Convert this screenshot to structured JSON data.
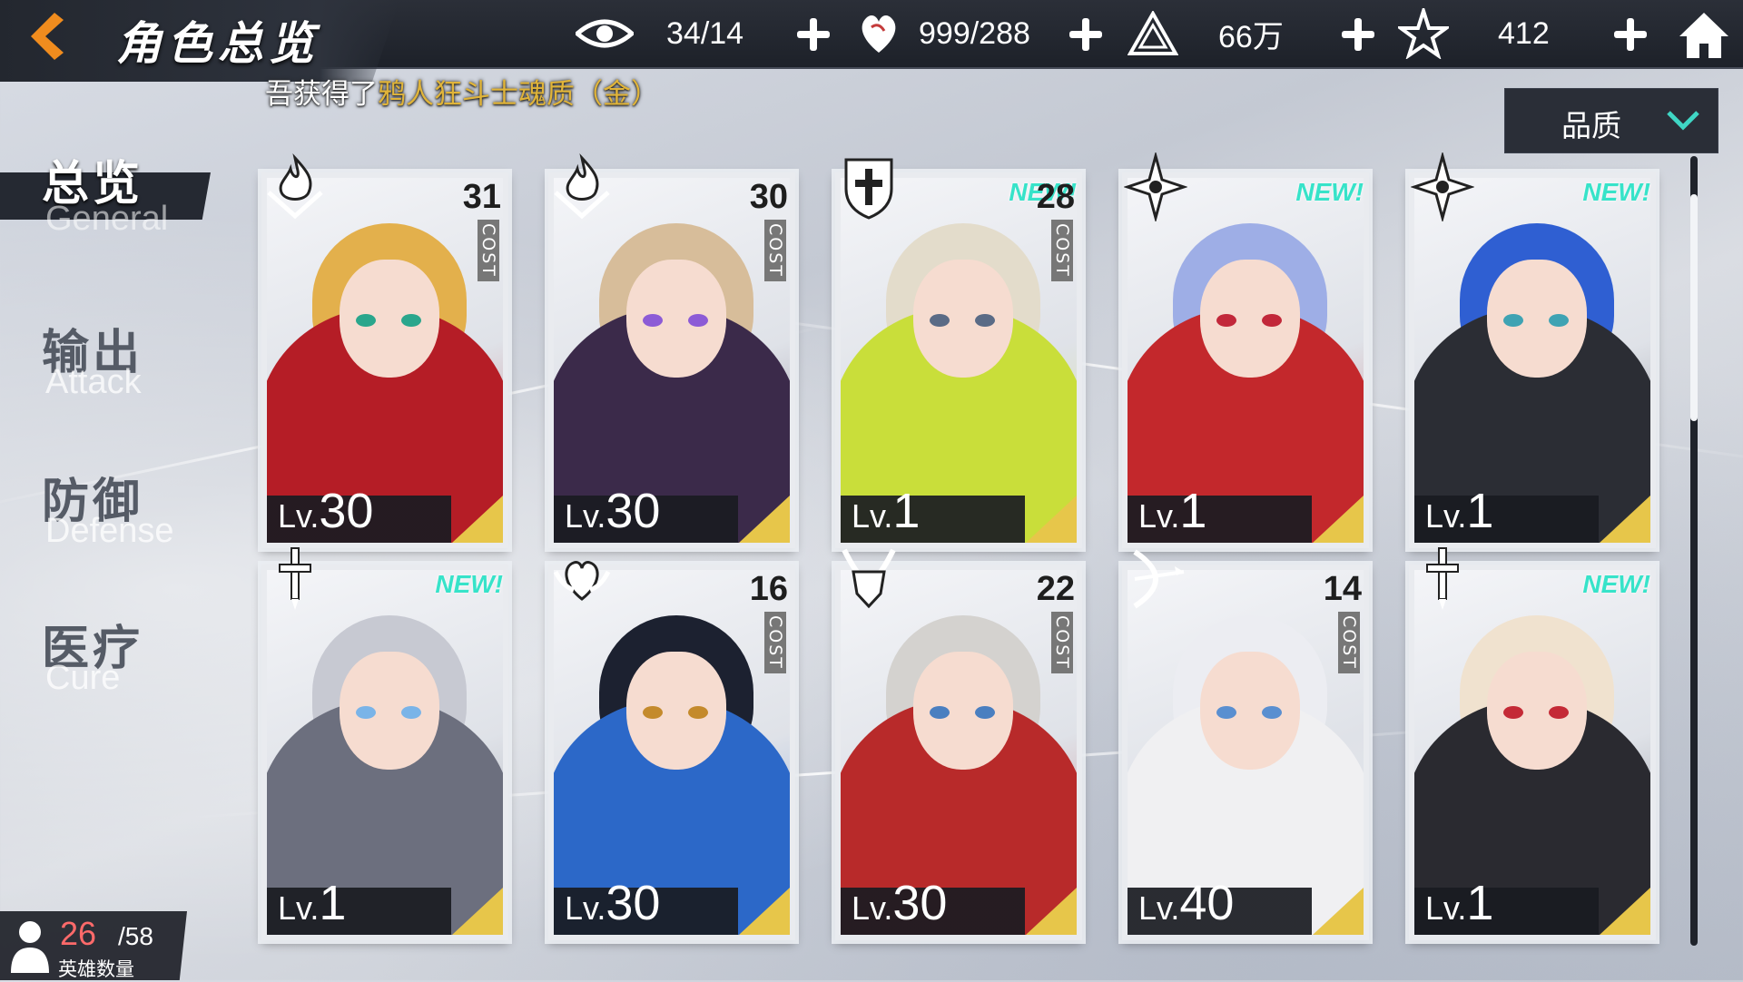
{
  "header": {
    "title": "角色总览",
    "resources": [
      {
        "icon": "eye-icon",
        "value": "34/14"
      },
      {
        "icon": "heart-icon",
        "value": "999/288"
      },
      {
        "icon": "triangle-crystal-icon",
        "value": "66万"
      },
      {
        "icon": "star-gem-icon",
        "value": "412"
      }
    ]
  },
  "notice": {
    "prefix": "吾获得了",
    "highlight": "鸦人狂斗士魂质（金）"
  },
  "sort": {
    "label": "品质"
  },
  "tabs": [
    {
      "cn": "总览",
      "en": "General",
      "active": true
    },
    {
      "cn": "输出",
      "en": "Attack",
      "active": false
    },
    {
      "cn": "防御",
      "en": "Defense",
      "active": false
    },
    {
      "cn": "医疗",
      "en": "Cure",
      "active": false
    }
  ],
  "cost_word": "COST",
  "lv_prefix": "Lv.",
  "new_badge": "NEW!",
  "cards": [
    {
      "class_icon": "flame-icon",
      "cost": "31",
      "level": "30",
      "new": false,
      "hair": "#e3b04c",
      "cape": "#b51d26",
      "eye": "#2aa68c"
    },
    {
      "class_icon": "flame-icon",
      "cost": "30",
      "level": "30",
      "new": false,
      "hair": "#d7bd9a",
      "cape": "#3b2a4a",
      "eye": "#8c5bd6"
    },
    {
      "class_icon": "shield-cross-icon",
      "cost": "28",
      "level": "1",
      "new": true,
      "hair": "#e3dccb",
      "cape": "#c9de3a",
      "eye": "#5a6b86"
    },
    {
      "class_icon": "shuriken-icon",
      "cost": "",
      "level": "1",
      "new": true,
      "hair": "#9eaee6",
      "cape": "#c3282c",
      "eye": "#c2283a"
    },
    {
      "class_icon": "shuriken-icon",
      "cost": "",
      "level": "1",
      "new": true,
      "hair": "#2f5fd2",
      "cape": "#2b2d34",
      "eye": "#3fa3b3"
    },
    {
      "class_icon": "sword-icon",
      "cost": "",
      "level": "1",
      "new": true,
      "hair": "#c7c9d2",
      "cape": "#6c6f7e",
      "eye": "#7ab4e8"
    },
    {
      "class_icon": "heart-wings-icon",
      "cost": "16",
      "level": "30",
      "new": false,
      "hair": "#1c2130",
      "cape": "#2c68c8",
      "eye": "#c48a2c"
    },
    {
      "class_icon": "demon-horns-icon",
      "cost": "22",
      "level": "30",
      "new": false,
      "hair": "#d4d2cf",
      "cape": "#b82a2a",
      "eye": "#4a7fc0"
    },
    {
      "class_icon": "bow-icon",
      "cost": "14",
      "level": "40",
      "new": false,
      "hair": "#ecedf2",
      "cape": "#f0f0f2",
      "eye": "#5a8fd0"
    },
    {
      "class_icon": "sword-icon",
      "cost": "",
      "level": "1",
      "new": true,
      "hair": "#f0e2cf",
      "cape": "#2a2a30",
      "eye": "#c42a36"
    }
  ],
  "hero_count": {
    "current": "26",
    "total": "/58",
    "label": "英雄数量"
  }
}
